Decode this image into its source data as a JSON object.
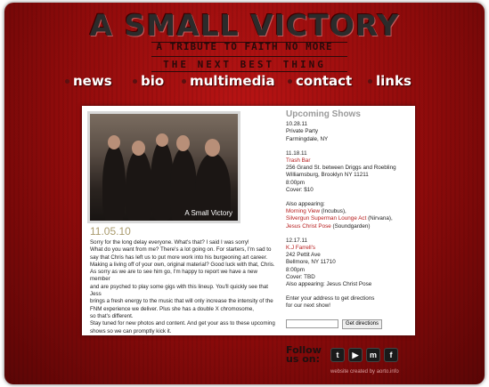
{
  "header": {
    "title": "A SMALL VICTORY",
    "subtitle": "A TRIBUTE TO FAITH NO MORE",
    "tagline": "THE NEXT BEST THING"
  },
  "nav": [
    {
      "label": "news"
    },
    {
      "label": "bio"
    },
    {
      "label": "multimedia"
    },
    {
      "label": "contact"
    },
    {
      "label": "links"
    }
  ],
  "photo": {
    "caption": "A Small Victory"
  },
  "post": {
    "date": "11.05.10",
    "lines": [
      "Sorry for the long delay everyone. What's that? I said I was sorry!",
      "What do you want from me? There's a lot going on. For starters, I'm sad to",
      "say that Chris has left us to put more work into his burgeoning art career.",
      "Making a living off of your own, original material? Good luck with that, Chris.",
      "As sorry as we are to see him go, I'm happy to report we have a new member",
      "and are psyched to play some gigs with this lineup. You'll quickly see that Jess",
      "brings a fresh energy to the music that will only increase the intensity of the",
      "FNM experience we deliver. Plus she has a double X chromosome,",
      "so that's different.",
      "Stay tuned for new photos and content. And get your ass to these upcoming",
      "shows so we can promptly kick it."
    ]
  },
  "shows": {
    "heading": "Upcoming Shows",
    "list": [
      {
        "date": "10.28.11",
        "lines": [
          "Private Party",
          "Farmingdale, NY"
        ]
      },
      {
        "date": "11.18.11",
        "venue": "Trash Bar",
        "lines": [
          "256 Grand St. between Driggs and Roebling",
          "Williamsburg, Brooklyn NY 11211",
          "8:00pm",
          "Cover: $10"
        ],
        "also_label": "Also appearing:",
        "also": [
          {
            "name": "Morning View",
            "note": " (Incubus),"
          },
          {
            "name": "Silvergun Superman Lounge Act",
            "note": " (Nirvana),"
          },
          {
            "name": "Jesus Christ Pose",
            "note": " (Soundgarden)"
          }
        ]
      },
      {
        "date": "12.17.11",
        "venue": "K.J Farrell's",
        "lines": [
          "242 Pettit Ave",
          "Bellmore, NY 11710",
          "8:00pm",
          "Cover: TBD",
          "Also appearing: Jesus Christ Pose"
        ]
      }
    ],
    "signup_text_1": "Enter your address to get directions",
    "signup_text_2": "for our next show!",
    "directions_placeholder": "",
    "directions_button": "Get directions"
  },
  "footer": {
    "follow_1": "Follow",
    "follow_2": "us on:",
    "social": [
      {
        "icon": "twitter-icon",
        "glyph": "t"
      },
      {
        "icon": "youtube-icon",
        "glyph": "▶"
      },
      {
        "icon": "myspace-icon",
        "glyph": "m"
      },
      {
        "icon": "facebook-icon",
        "glyph": "f"
      }
    ],
    "credit": "website created by aorto.info"
  },
  "colors": {
    "background": "#8e0b0b",
    "accent_red": "#b71c1c",
    "date_gold": "#aa9b6e"
  }
}
